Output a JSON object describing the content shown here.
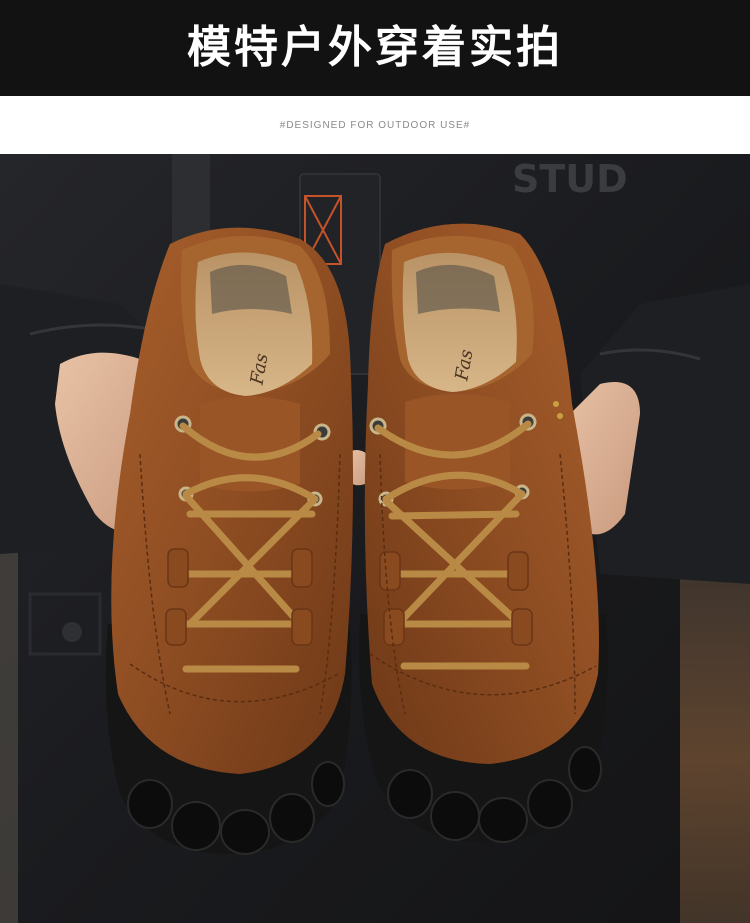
{
  "header": {
    "title": "模特户外穿着实拍",
    "background_color": "#121212",
    "title_color": "#ffffff"
  },
  "subheader": {
    "tagline": "#DESIGNED FOR OUTDOOR USE#",
    "color": "#8a8a8a"
  },
  "photo": {
    "subject": "model holding a pair of brown leather outdoor shoes",
    "jacket_print_text": "STUD",
    "left_insole_brand": "Fas",
    "right_insole_brand": "Fas",
    "colors": {
      "leather": "#8e4d22",
      "laces": "#b98a45",
      "sole": "#151515",
      "insole": "#c9a577",
      "jacket": "#1c1d20"
    }
  }
}
